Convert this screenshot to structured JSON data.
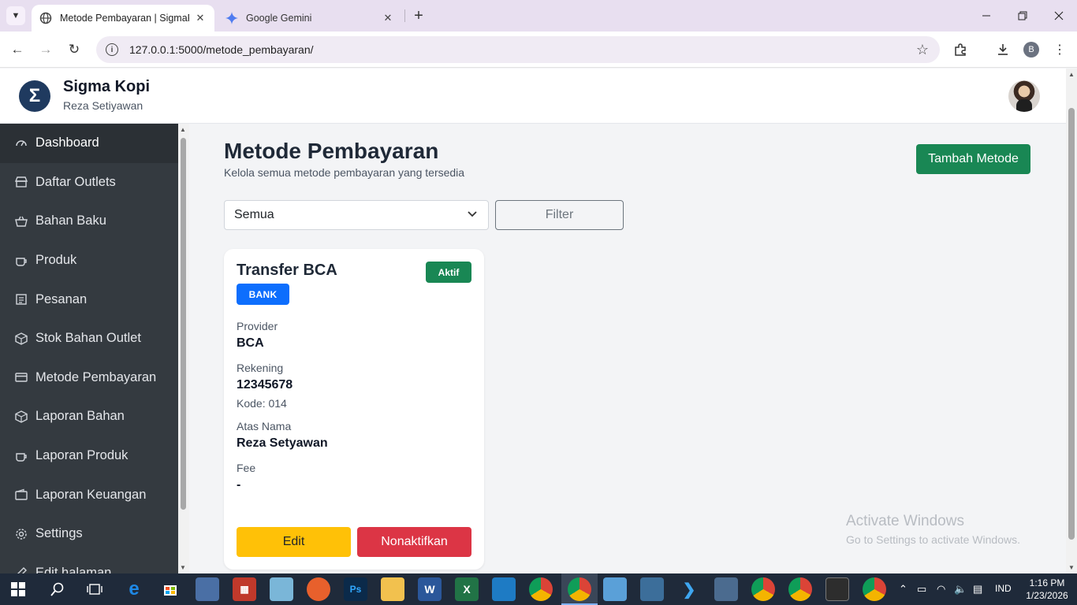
{
  "browser": {
    "tabs": [
      {
        "title": "Metode Pembayaran | SigmaFra",
        "active": true
      },
      {
        "title": "Google Gemini",
        "active": false
      }
    ],
    "url": "127.0.0.1:5000/metode_pembayaran/",
    "profile_initial": "B"
  },
  "header": {
    "brand": "Sigma Kopi",
    "user": "Reza Setiyawan",
    "logo_letter": "Σ"
  },
  "sidebar": {
    "items": [
      {
        "label": "Dashboard",
        "icon": "gauge-icon",
        "active": true
      },
      {
        "label": "Daftar Outlets",
        "icon": "store-icon"
      },
      {
        "label": "Bahan Baku",
        "icon": "basket-icon"
      },
      {
        "label": "Produk",
        "icon": "cup-icon"
      },
      {
        "label": "Pesanan",
        "icon": "list-icon"
      },
      {
        "label": "Stok Bahan Outlet",
        "icon": "box-icon"
      },
      {
        "label": "Metode Pembayaran",
        "icon": "card-icon"
      },
      {
        "label": "Laporan Bahan",
        "icon": "box-icon"
      },
      {
        "label": "Laporan Produk",
        "icon": "cup-icon"
      },
      {
        "label": "Laporan Keuangan",
        "icon": "wallet-icon"
      },
      {
        "label": "Settings",
        "icon": "gear-icon"
      },
      {
        "label": "Edit halaman",
        "icon": "edit-icon"
      }
    ]
  },
  "main": {
    "title": "Metode Pembayaran",
    "subtitle": "Kelola semua metode pembayaran yang tersedia",
    "add_button": "Tambah Metode",
    "filter_select_value": "Semua",
    "filter_button": "Filter"
  },
  "card": {
    "name": "Transfer BCA",
    "status": "Aktif",
    "type": "BANK",
    "provider_label": "Provider",
    "provider": "BCA",
    "account_label": "Rekening",
    "account": "12345678",
    "code": "Kode: 014",
    "holder_label": "Atas Nama",
    "holder": "Reza Setyawan",
    "fee_label": "Fee",
    "fee": "-",
    "edit_button": "Edit",
    "deactivate_button": "Nonaktifkan"
  },
  "watermark": {
    "line1": "Activate Windows",
    "line2": "Go to Settings to activate Windows."
  },
  "taskbar": {
    "language": "IND",
    "time": "1:16 PM",
    "date": "1/23/2026"
  },
  "colors": {
    "sidebar_bg": "#343a40",
    "success": "#198754",
    "primary": "#0d6efd",
    "warning": "#ffc107",
    "danger": "#dc3545"
  }
}
